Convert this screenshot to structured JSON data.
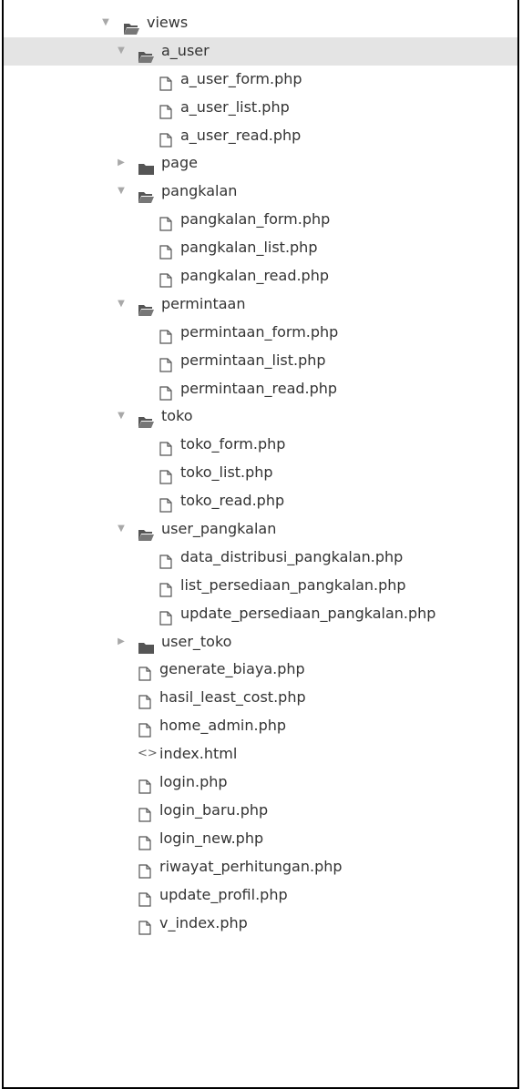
{
  "tree": [
    {
      "label": "views",
      "kind": "folder",
      "open": true,
      "depth": 0
    },
    {
      "label": "a_user",
      "kind": "folder",
      "open": true,
      "depth": 1,
      "selected": true
    },
    {
      "label": "a_user_form.php",
      "kind": "file",
      "depth": 2
    },
    {
      "label": "a_user_list.php",
      "kind": "file",
      "depth": 2
    },
    {
      "label": "a_user_read.php",
      "kind": "file",
      "depth": 2
    },
    {
      "label": "page",
      "kind": "folder",
      "open": false,
      "depth": 1
    },
    {
      "label": "pangkalan",
      "kind": "folder",
      "open": true,
      "depth": 1
    },
    {
      "label": "pangkalan_form.php",
      "kind": "file",
      "depth": 2
    },
    {
      "label": "pangkalan_list.php",
      "kind": "file",
      "depth": 2
    },
    {
      "label": "pangkalan_read.php",
      "kind": "file",
      "depth": 2
    },
    {
      "label": "permintaan",
      "kind": "folder",
      "open": true,
      "depth": 1
    },
    {
      "label": "permintaan_form.php",
      "kind": "file",
      "depth": 2
    },
    {
      "label": "permintaan_list.php",
      "kind": "file",
      "depth": 2
    },
    {
      "label": "permintaan_read.php",
      "kind": "file",
      "depth": 2
    },
    {
      "label": "toko",
      "kind": "folder",
      "open": true,
      "depth": 1
    },
    {
      "label": "toko_form.php",
      "kind": "file",
      "depth": 2
    },
    {
      "label": "toko_list.php",
      "kind": "file",
      "depth": 2
    },
    {
      "label": "toko_read.php",
      "kind": "file",
      "depth": 2
    },
    {
      "label": "user_pangkalan",
      "kind": "folder",
      "open": true,
      "depth": 1
    },
    {
      "label": "data_distribusi_pangkalan.php",
      "kind": "file",
      "depth": 2
    },
    {
      "label": "list_persediaan_pangkalan.php",
      "kind": "file",
      "depth": 2
    },
    {
      "label": "update_persediaan_pangkalan.php",
      "kind": "file",
      "depth": 2
    },
    {
      "label": "user_toko",
      "kind": "folder",
      "open": false,
      "depth": 1
    },
    {
      "label": "generate_biaya.php",
      "kind": "file",
      "depth": 1
    },
    {
      "label": "hasil_least_cost.php",
      "kind": "file",
      "depth": 1
    },
    {
      "label": "home_admin.php",
      "kind": "file",
      "depth": 1
    },
    {
      "label": "index.html",
      "kind": "code",
      "depth": 1
    },
    {
      "label": "login.php",
      "kind": "file",
      "depth": 1
    },
    {
      "label": "login_baru.php",
      "kind": "file",
      "depth": 1
    },
    {
      "label": "login_new.php",
      "kind": "file",
      "depth": 1
    },
    {
      "label": "riwayat_perhitungan.php",
      "kind": "file",
      "depth": 1
    },
    {
      "label": "update_profil.php",
      "kind": "file",
      "depth": 1
    },
    {
      "label": "v_index.php",
      "kind": "file",
      "depth": 1
    }
  ],
  "icons": {
    "folder": "folder-icon",
    "file": "file-icon",
    "code": "code-file-icon",
    "expanded": "triangle-down-icon",
    "collapsed": "triangle-right-icon"
  },
  "colors": {
    "selected_row": "#e4e4e4",
    "icon": "#555555",
    "arrow": "#a8a8a8",
    "text": "#333333"
  }
}
